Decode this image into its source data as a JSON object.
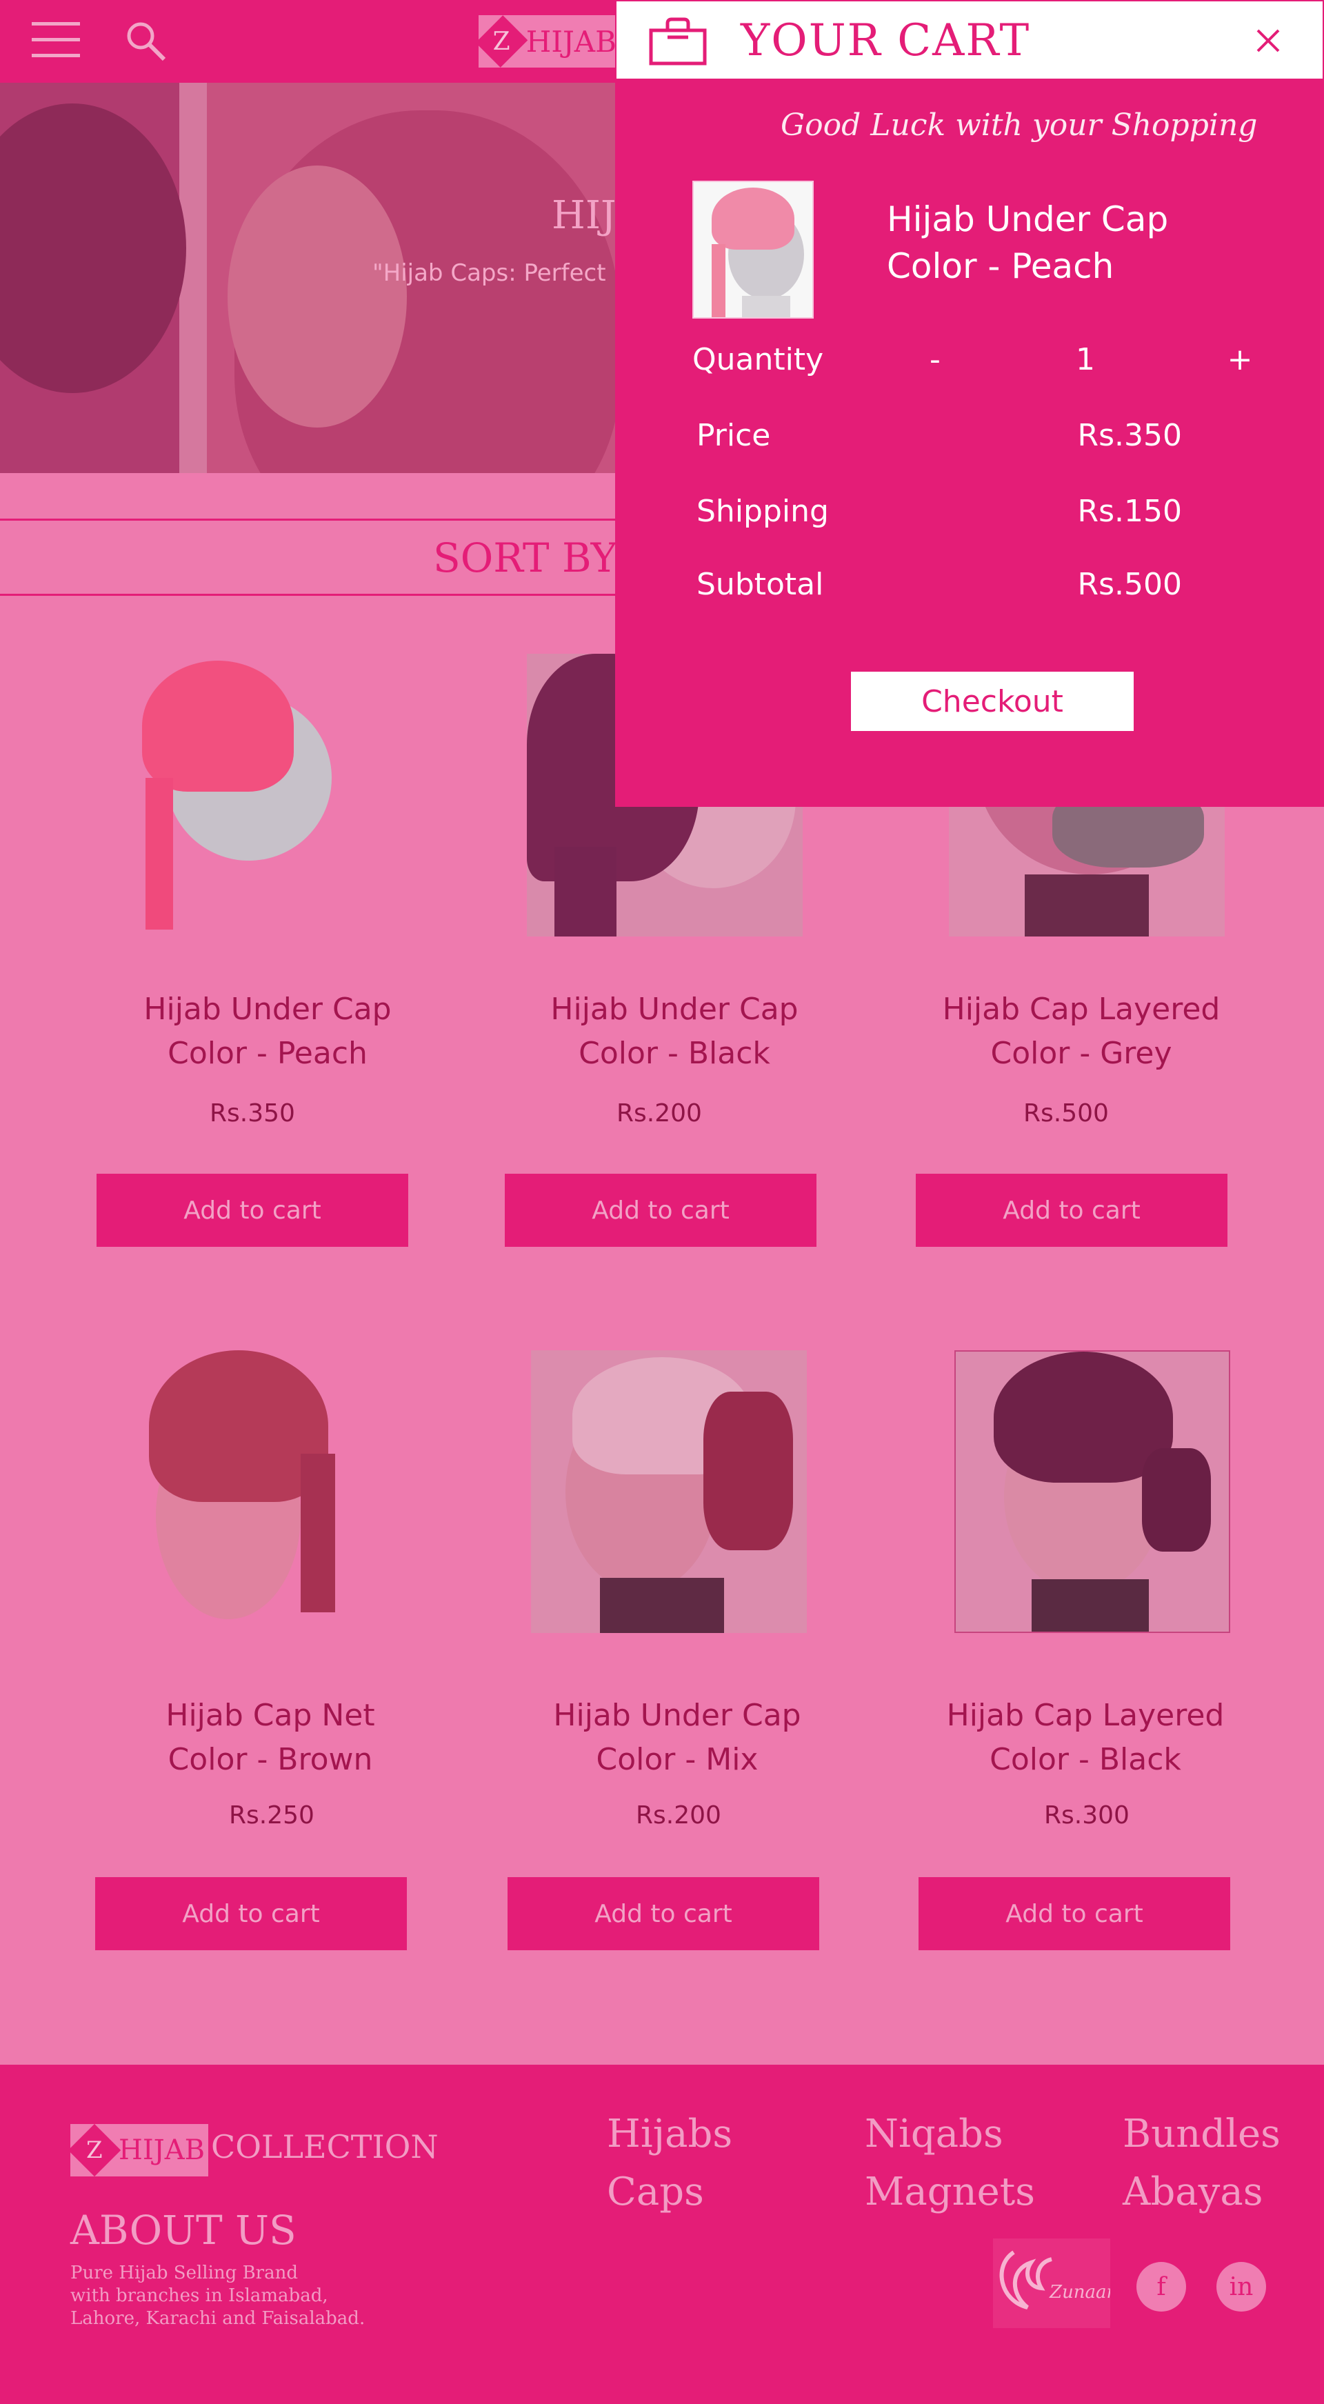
{
  "colors": {
    "brand": "#e41d77",
    "page_bg": "#ee7aae",
    "white": "#ffffff"
  },
  "header": {
    "menu_icon": "hamburger-icon",
    "search_icon": "search-icon",
    "logo_letter": "Z",
    "logo_text": "HIJAB"
  },
  "hero": {
    "title": "HIJA",
    "subtitle": "\"Hijab Caps: Perfect"
  },
  "sort": {
    "label": "SORT BY"
  },
  "products": [
    {
      "name_line1": "Hijab Under Cap",
      "name_line2": "Color - Peach",
      "price": "Rs.350",
      "button": "Add to cart"
    },
    {
      "name_line1": "Hijab Under Cap",
      "name_line2": "Color - Black",
      "price": "Rs.200",
      "button": "Add to cart"
    },
    {
      "name_line1": "Hijab Cap Layered",
      "name_line2": "Color - Grey",
      "price": "Rs.500",
      "button": "Add to cart"
    },
    {
      "name_line1": "Hijab Cap Net",
      "name_line2": "Color - Brown",
      "price": "Rs.250",
      "button": "Add to cart"
    },
    {
      "name_line1": "Hijab Under Cap",
      "name_line2": "Color - Mix",
      "price": "Rs.200",
      "button": "Add to cart"
    },
    {
      "name_line1": "Hijab Cap Layered",
      "name_line2": "Color - Black",
      "price": "Rs.300",
      "button": "Add to cart"
    }
  ],
  "cart": {
    "title": "YOUR CART",
    "bag_icon": "shopping-bag-icon",
    "close_icon": "close-icon",
    "tagline": "Good Luck with your Shopping",
    "item_name_line1": "Hijab Under Cap",
    "item_name_line2": "Color - Peach",
    "quantity_label": "Quantity",
    "decrement": "-",
    "quantity": "1",
    "increment": "+",
    "price_label": "Price",
    "price": "Rs.350",
    "shipping_label": "Shipping",
    "shipping": "Rs.150",
    "subtotal_label": "Subtotal",
    "subtotal": "Rs.500",
    "checkout": "Checkout"
  },
  "footer": {
    "logo_letter": "Z",
    "logo_text": "HIJAB",
    "logo_word": "COLLECTION",
    "about_title": "ABOUT US",
    "about_line1": "Pure Hijab Selling Brand",
    "about_line2": "with branches in Islamabad,",
    "about_line3": "Lahore, Karachi and Faisalabad.",
    "links": [
      "Hijabs",
      "Niqabs",
      "Bundles",
      "Caps",
      "Magnets",
      "Abayas"
    ],
    "partner_logo": "zunaara-logo",
    "social": [
      "f",
      "in"
    ]
  }
}
